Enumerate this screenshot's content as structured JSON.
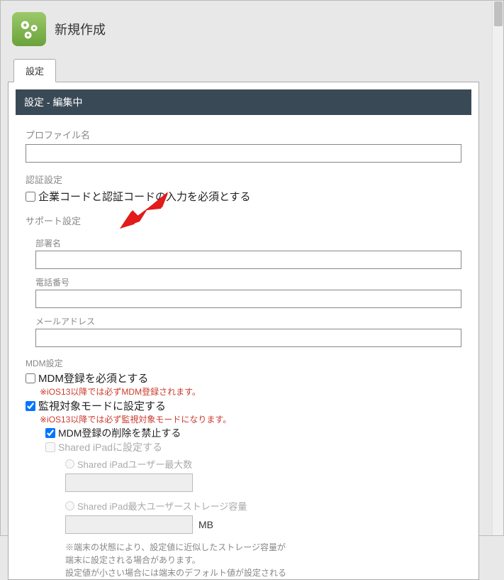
{
  "header": {
    "title": "新規作成"
  },
  "tab": {
    "label": "設定"
  },
  "panel": {
    "heading": "設定 - 編集中"
  },
  "fields": {
    "profile_name_label": "プロファイル名",
    "profile_name_value": "",
    "auth_section_label": "認証設定",
    "auth_checkbox_label": "企業コードと認証コードの入力を必須とする",
    "support_section_label": "サポート設定",
    "dept_label": "部署名",
    "dept_value": "",
    "phone_label": "電話番号",
    "phone_value": "",
    "email_label": "メールアドレス",
    "email_value": "",
    "mdm_section_label": "MDM設定",
    "mdm_required_label": "MDM登録を必須とする",
    "mdm_required_hint": "※iOS13以降では必ずMDM登録されます。",
    "supervised_label": "監視対象モードに設定する",
    "supervised_hint": "※iOS13以降では必ず監視対象モードになります。",
    "mdm_delete_label": "MDM登録の削除を禁止する",
    "shared_ipad_label": "Shared iPadに設定する",
    "shared_ipad_max_users_label": "Shared iPadユーザー最大数",
    "shared_ipad_max_users_value": "",
    "shared_ipad_storage_label": "Shared iPad最大ユーザーストレージ容量",
    "shared_ipad_storage_value": "",
    "shared_ipad_storage_unit": "MB",
    "storage_hint_line1": "※端末の状態により、設定値に近似したストレージ容量が",
    "storage_hint_line2": "端末に設定される場合があります。",
    "storage_hint_line3_partial": "設定値が小さい場合には端末のデフォルト値が設定される"
  },
  "state": {
    "auth_checked": false,
    "mdm_required_checked": false,
    "supervised_checked": true,
    "mdm_delete_checked": true,
    "shared_ipad_checked": false,
    "shared_radio_users": false,
    "shared_radio_storage": false
  }
}
